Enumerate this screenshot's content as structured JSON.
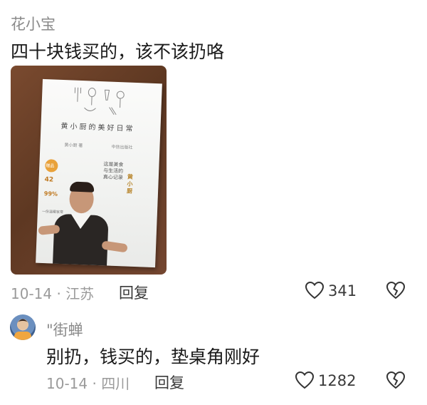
{
  "comment1": {
    "user": "花小宝",
    "text": "四十块钱买的，该不该扔咯",
    "date_location": "10-14 · 江苏",
    "reply_label": "回复",
    "likes": "341"
  },
  "book_cover": {
    "title": "黄小厨的美好日常",
    "subtitle_left": "黄小厨 著",
    "subtitle_right": "中信出版社",
    "badge": "赠品",
    "stat1": "42",
    "stat2": "99%",
    "side_text": "一份温暖家常",
    "gold_text": "黄小厨",
    "vertical_text": "这是美食与生活的真心记录"
  },
  "comment2": {
    "user": "\"街蝉",
    "text": "别扔，钱买的，垫桌角刚好",
    "date_location": "10-14 · 四川",
    "reply_label": "回复",
    "likes": "1282"
  },
  "icons": {
    "like": "heart-outline-icon",
    "dislike": "broken-heart-icon"
  }
}
